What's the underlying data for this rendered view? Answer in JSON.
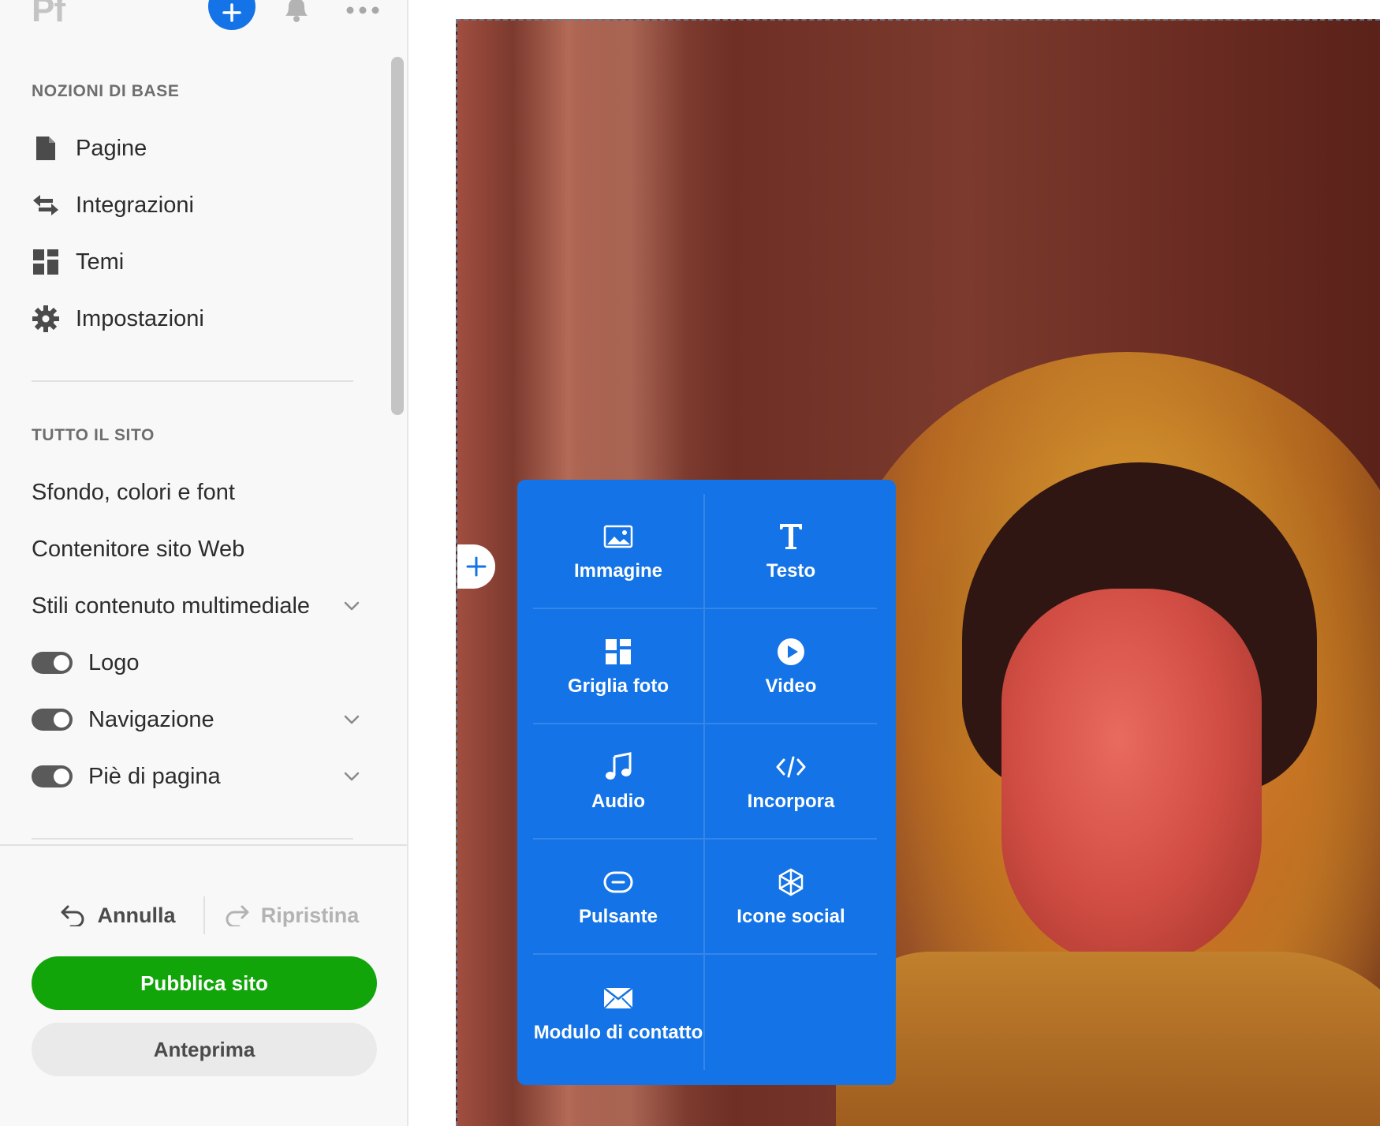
{
  "topbar": {
    "app_logo": "Pf",
    "add_icon": "plus-icon",
    "bell_icon": "bell-icon",
    "more_icon": "more-icon"
  },
  "sidebar": {
    "basics_heading": "NOZIONI DI BASE",
    "basics_items": [
      {
        "label": "Pagine",
        "icon": "page-icon"
      },
      {
        "label": "Integrazioni",
        "icon": "integrations-icon"
      },
      {
        "label": "Temi",
        "icon": "themes-icon"
      },
      {
        "label": "Impostazioni",
        "icon": "gear-icon"
      }
    ],
    "site_heading": "TUTTO IL SITO",
    "site_items": [
      {
        "label": "Sfondo, colori e font"
      },
      {
        "label": "Contenitore sito Web"
      },
      {
        "label": "Stili contenuto multimediale",
        "expandable": true
      }
    ],
    "toggles": [
      {
        "label": "Logo",
        "on": true
      },
      {
        "label": "Navigazione",
        "on": true,
        "expandable": true
      },
      {
        "label": "Piè di pagina",
        "on": true,
        "expandable": true
      }
    ]
  },
  "footer": {
    "undo_label": "Annulla",
    "redo_label": "Ripristina",
    "publish_label": "Pubblica sito",
    "preview_label": "Anteprima"
  },
  "insert_menu": {
    "items": [
      {
        "label": "Immagine",
        "icon": "image-icon"
      },
      {
        "label": "Testo",
        "icon": "text-icon"
      },
      {
        "label": "Griglia foto",
        "icon": "photo-grid-icon"
      },
      {
        "label": "Video",
        "icon": "video-icon"
      },
      {
        "label": "Audio",
        "icon": "music-note-icon"
      },
      {
        "label": "Incorpora",
        "icon": "code-icon"
      },
      {
        "label": "Pulsante",
        "icon": "button-icon"
      },
      {
        "label": "Icone social",
        "icon": "social-icon"
      },
      {
        "label": "Modulo di contatto",
        "icon": "envelope-icon"
      }
    ]
  },
  "colors": {
    "accent": "#1473e6",
    "publish": "#12a50a",
    "sidebar_bg": "#f8f8f8"
  }
}
